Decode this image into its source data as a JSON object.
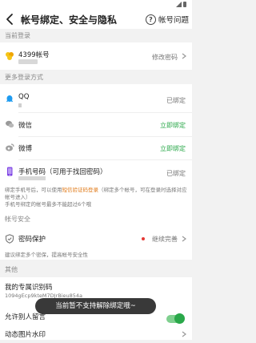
{
  "header": {
    "title": "帐号绑定、安全与隐私",
    "help_label": "帐号问题"
  },
  "current_login": {
    "section_label": "当前登录",
    "account_name": "4399帐号",
    "action": "修改密码"
  },
  "more_login": {
    "section_label": "更多登录方式",
    "qq": {
      "label": "QQ",
      "status": "已绑定"
    },
    "wechat": {
      "label": "微信",
      "status": "立即绑定"
    },
    "weibo": {
      "label": "微博",
      "status": "立即绑定"
    },
    "phone": {
      "label": "手机号码（可用于找回密码）",
      "status": "已绑定"
    },
    "note_part1": "绑定手机号后，可以使用",
    "note_highlight": "短信验证码登录",
    "note_part2": "（绑定多个帐号，可在登录时选择对应帐号进入）",
    "note_line2": "手机号绑定的帐号最多不能超过6个哦"
  },
  "account_security": {
    "section_label": "帐号安全",
    "password_protect": {
      "label": "密码保护",
      "action": "继续完善"
    },
    "note": "建议绑定多个密保，提高帐号安全性"
  },
  "other": {
    "section_label": "其他",
    "id_code": {
      "label": "我的专属识别码",
      "value": "1094gEcp9kteM7DJrBieu854a"
    },
    "allow_comments": {
      "label": "允许别人留言"
    },
    "watermark": {
      "label": "动态图片水印"
    }
  },
  "toast": {
    "text": "当前暂不支持解除绑定哦~"
  },
  "colors": {
    "accent_green": "#2aa84a",
    "highlight_orange": "#e07b1b",
    "red_dot": "#e53935"
  },
  "icons": [
    "back-icon",
    "help-icon",
    "4399-logo-icon",
    "qq-icon",
    "wechat-icon",
    "weibo-icon",
    "phone-icon",
    "shield-icon",
    "chevron-right-icon"
  ]
}
